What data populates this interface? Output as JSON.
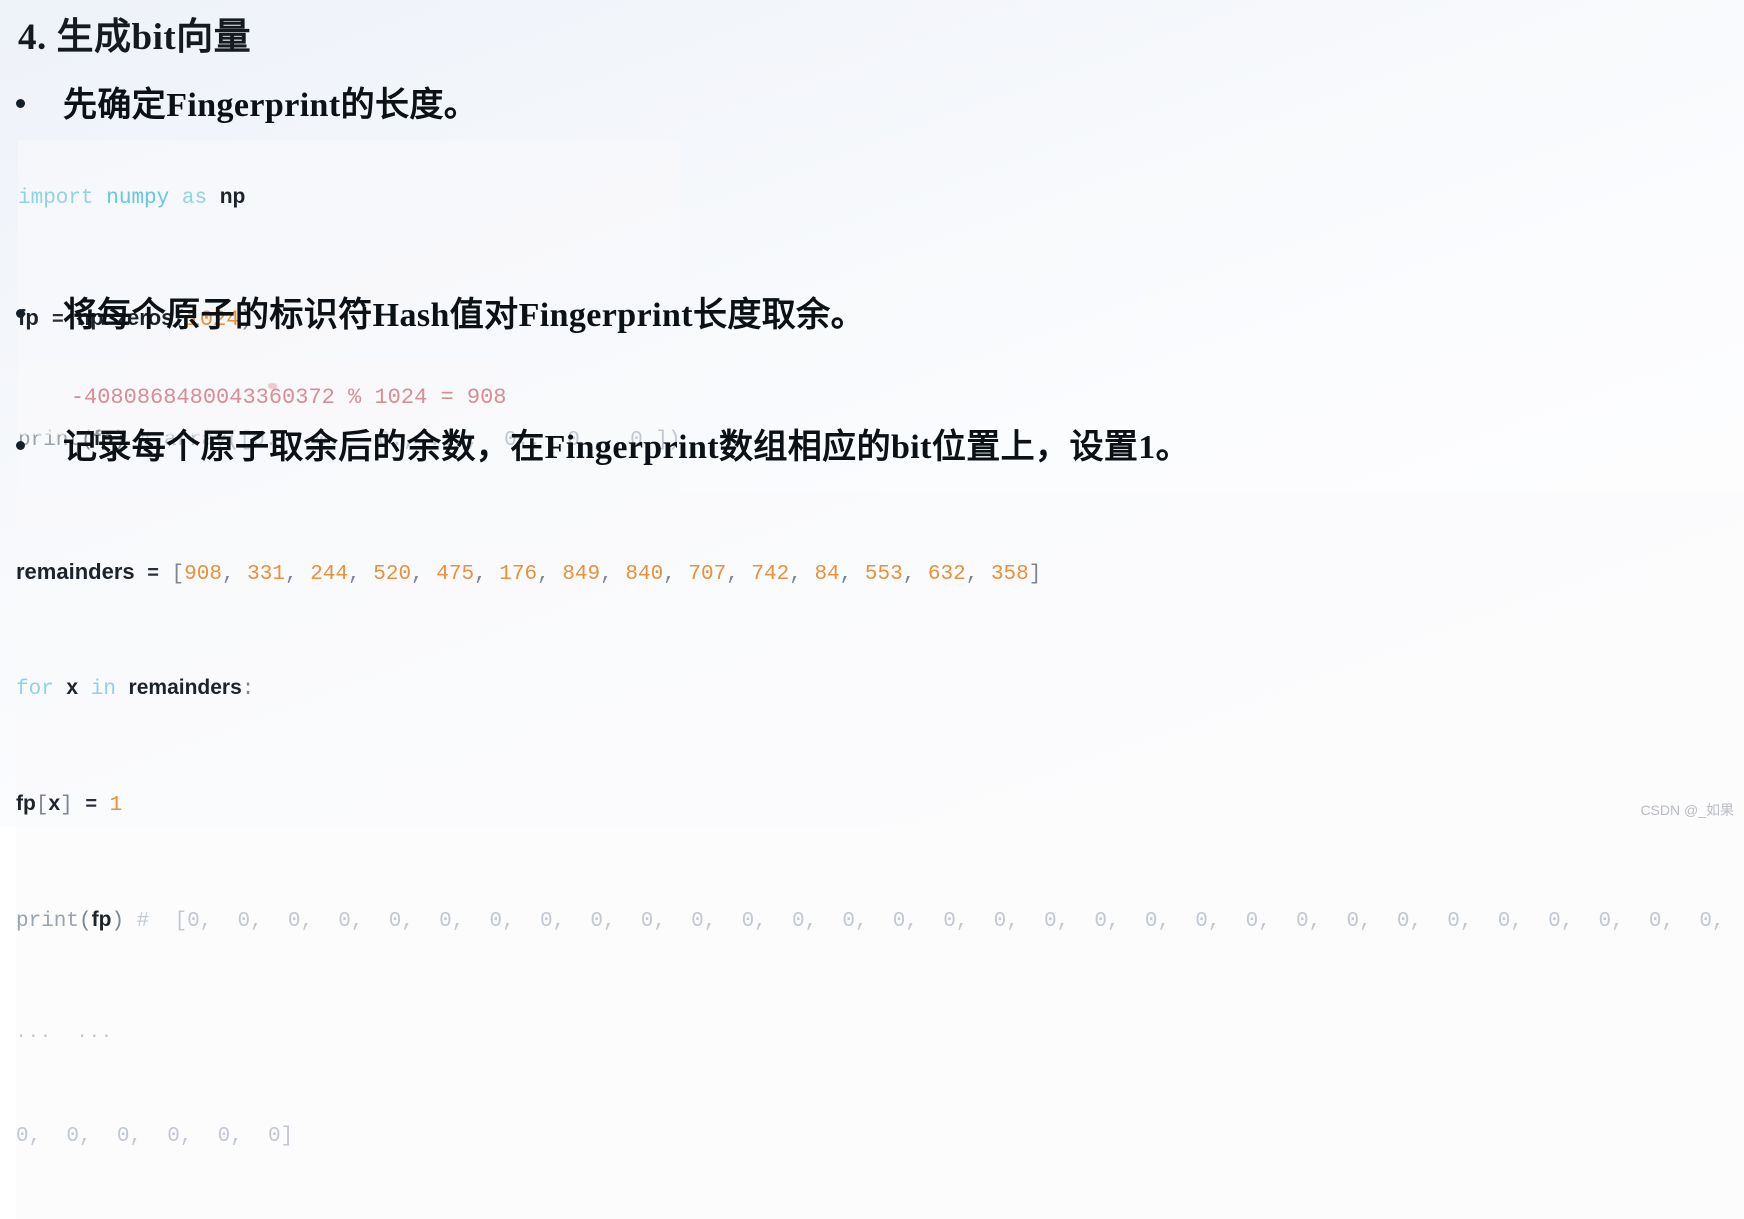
{
  "slide": {
    "title": "4. 生成bit向量",
    "watermark": "CSDN @_如果"
  },
  "bullets": [
    {
      "id": "b1",
      "text": "先确定Fingerprint的长度。"
    },
    {
      "id": "b2",
      "text": "将每个原子的标识符Hash值对Fingerprint长度取余。"
    },
    {
      "id": "b3",
      "text": "记录每个原子取余后的余数，在Fingerprint数组相应的bit位置上，设置1。"
    }
  ],
  "code1": {
    "line1": {
      "kw_import": "import",
      "module": "numpy",
      "kw_as": "as",
      "alias": "np"
    },
    "line2": {
      "var": "fp",
      "eq": "=",
      "call": "np. zeros",
      "open": "(",
      "number": "1024",
      "close": ")"
    },
    "line3": {
      "fn": "print",
      "open": "(",
      "arg": "fp",
      "close": ")",
      "comment": "# array([0.,  0.,  0., ...,  0.,  0.,  0.])"
    }
  },
  "code2": {
    "expression": "-4080868480043360372 % 1024 = 908"
  },
  "code3": {
    "line1": {
      "var": "remainders",
      "eq": "=",
      "open": "[",
      "values": [
        "908",
        "331",
        "244",
        "520",
        "475",
        "176",
        "849",
        "840",
        "707",
        "742",
        "84",
        "553",
        "632",
        "358"
      ],
      "close": "]"
    },
    "line2": {
      "kw_for": "for",
      "iter": "x",
      "kw_in": "in",
      "seq": "remainders",
      "colon": ":"
    },
    "line3": {
      "target": "fp",
      "index_open": "[",
      "index": "x",
      "index_close": "]",
      "eq": "=",
      "value": "1"
    },
    "line4": {
      "fn": "print",
      "open": "(",
      "arg": "fp",
      "close": ")",
      "comment": "#  [0,  0,  0,  0,  0,  0,  0,  0,  0,  0,  0,  0,  0,  0,  0,  0,  0,  0,  0,  0,  0,  0,  0,  0,  0,  0,  0,  0,  0,  0,  0,  0,  0,  0,  0,"
    },
    "line5": {
      "ellipsis": "...  ..."
    },
    "line6": {
      "tail": "0,  0,  0,  0,  0,  0]"
    }
  },
  "colors": {
    "keyword": "#8fd3e8",
    "module": "#63c9e0",
    "number": "#e8903c",
    "comment": "#c2c8d2",
    "pink": "#d98c97",
    "text": "#0c1116"
  }
}
